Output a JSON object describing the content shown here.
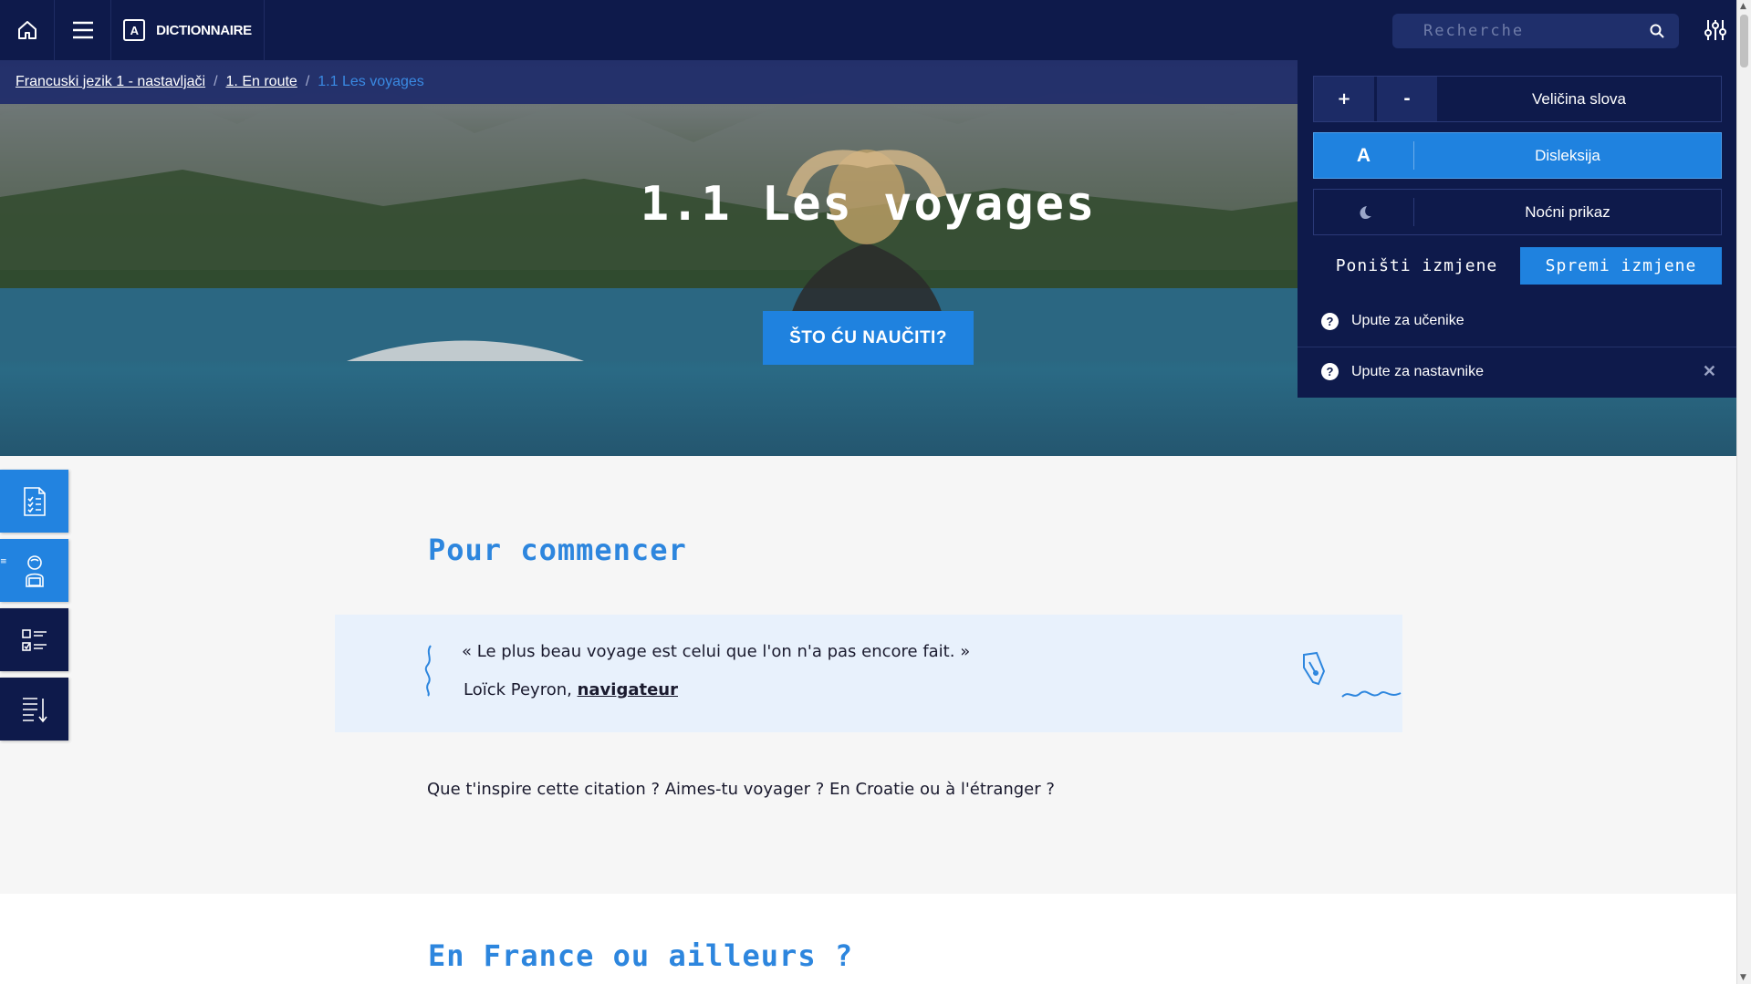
{
  "topbar": {
    "dictionary_label": "DICTIONNAIRE",
    "dictionary_badge": "A",
    "search_placeholder": "Recherche"
  },
  "breadcrumb": {
    "items": [
      "Francuski jezik 1 - nastavljači",
      "1. En route"
    ],
    "current": "1.1 Les voyages",
    "separator": "/"
  },
  "hero": {
    "title": "1.1 Les voyages",
    "button_label": "ŠTO ĆU NAUČITI?"
  },
  "settings_panel": {
    "font_increase": "+",
    "font_decrease": "-",
    "font_size_label": "Veličina slova",
    "dyslexia_icon": "A",
    "dyslexia_label": "Disleksija",
    "dyslexia_active": true,
    "night_label": "Noćni prikaz",
    "reset_label": "Poništi izmjene",
    "save_label": "Spremi izmjene",
    "help_students": "Upute za učenike",
    "help_teachers": "Upute za nastavnike",
    "help_icon": "?",
    "close_icon": "✕"
  },
  "side_tools": [
    "document-checklist-icon",
    "student-icon",
    "checklist-icon",
    "sort-list-icon"
  ],
  "content": {
    "section1_title": "Pour commencer",
    "quote_text": "« Le plus beau voyage est celui que l'on n'a pas encore fait. »",
    "quote_author": "Loïck Peyron, ",
    "quote_author_role": "navigateur",
    "paragraph": "Que t'inspire cette citation ? Aimes-tu voyager ? En Croatie ou à l'étranger ?",
    "section2_title": "En France ou ailleurs ?"
  },
  "colors": {
    "navy": "#0e1a4b",
    "accent_blue": "#1f82df",
    "heading_blue": "#2d86de",
    "quote_bg": "#e8f1fc"
  }
}
